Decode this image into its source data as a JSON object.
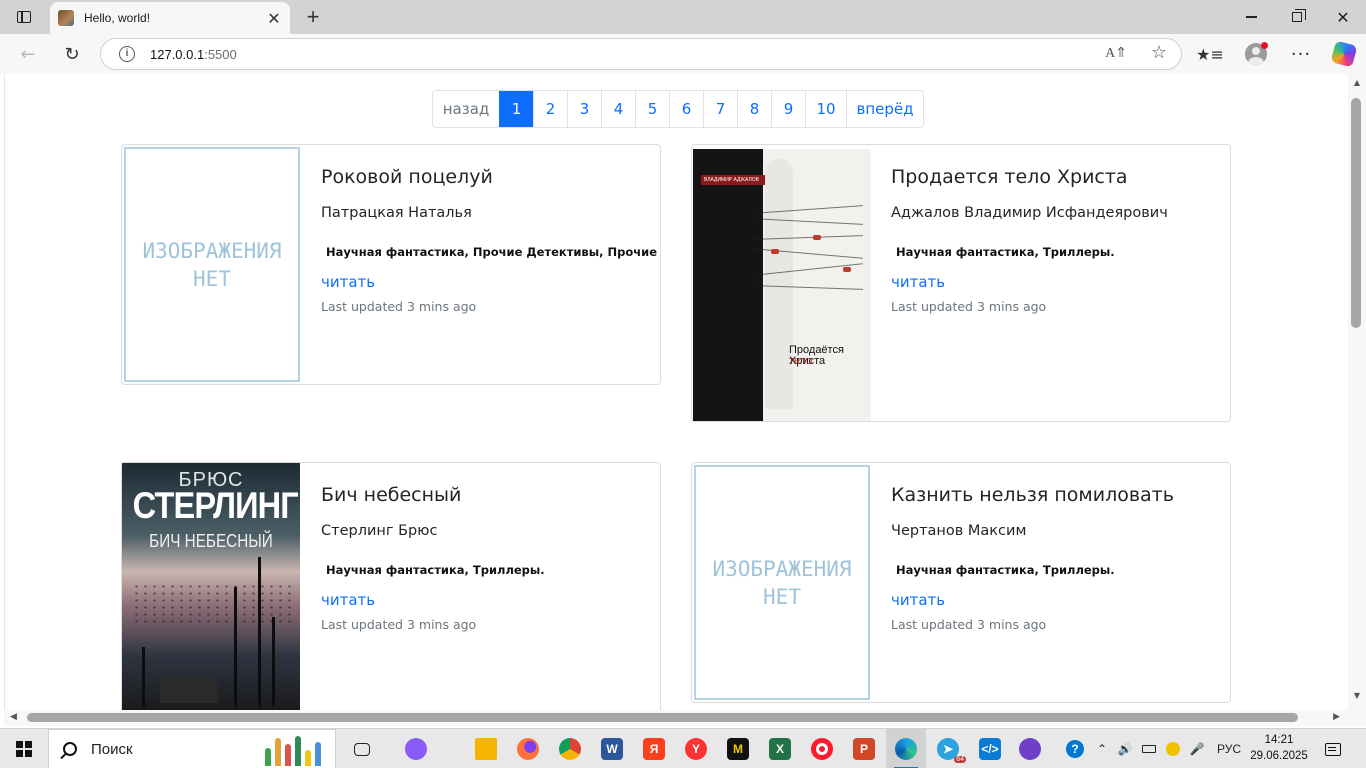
{
  "browser": {
    "tab_title": "Hello, world!",
    "new_tab_symbol": "+",
    "close_symbol": "✕",
    "address_host": "127.0.0.1",
    "address_port": ":5500",
    "icons": [
      "sidebar-icon",
      "back-icon",
      "reload-icon",
      "site-info-icon",
      "read-aloud-icon",
      "favorite-star-icon",
      "favorites-icon",
      "profile-icon",
      "more-icon",
      "copilot-icon"
    ]
  },
  "pagination": {
    "prev": "назад",
    "pages": [
      "1",
      "2",
      "3",
      "4",
      "5",
      "6",
      "7",
      "8",
      "9",
      "10"
    ],
    "active": "1",
    "next": "вперёд"
  },
  "no_image_text": [
    "ИЗОБРАЖЕНИЯ",
    "НЕТ"
  ],
  "books": [
    {
      "title": "Роковой поцелуй",
      "author": "Патрацкая Наталья",
      "genres": "Научная фантастика, Прочие Детективы, Прочие приключения",
      "read_label": "читать",
      "updated": "Last updated 3 mins ago",
      "cover": "none"
    },
    {
      "title": "Продается тело Христа",
      "author": "Аджалов Владимир Исфандеярович",
      "genres": "Научная фантастика, Триллеры.",
      "read_label": "читать",
      "updated": "Last updated 3 mins ago",
      "cover": "christ",
      "cover_text": {
        "header": "ВЛАДИМИР АДЖАЛОВ",
        "line1": "Продаётся",
        "line2": "тело",
        "line3": "Христа"
      }
    },
    {
      "title": "Бич небесный",
      "author": "Стерлинг Брюс",
      "genres": "Научная фантастика, Триллеры.",
      "read_label": "читать",
      "updated": "Last updated 3 mins ago",
      "cover": "sterling",
      "cover_text": {
        "line1": "БРЮС",
        "line2": "СТЕРЛИНГ",
        "line3": "БИЧ НЕБЕСНЫЙ"
      }
    },
    {
      "title": "Казнить нельзя помиловать",
      "author": "Чертанов Максим",
      "genres": "Научная фантастика, Триллеры.",
      "read_label": "читать",
      "updated": "Last updated 3 mins ago",
      "cover": "none"
    }
  ],
  "taskbar": {
    "search_label": "Поиск",
    "language": "РУС",
    "time": "14:21",
    "date": "29.06.2025",
    "telegram_badge": "64",
    "apps": [
      "task-view",
      "alice",
      "file-explorer",
      "firefox",
      "chrome",
      "word",
      "yandex",
      "yandex-browser",
      "mirage",
      "excel",
      "opera",
      "powerpoint",
      "edge",
      "telegram",
      "vscode",
      "github-desktop"
    ]
  },
  "colors": {
    "accent": "#0d6efd",
    "no_image_border": "#b6d4e4",
    "muted_text": "#6c757d"
  }
}
